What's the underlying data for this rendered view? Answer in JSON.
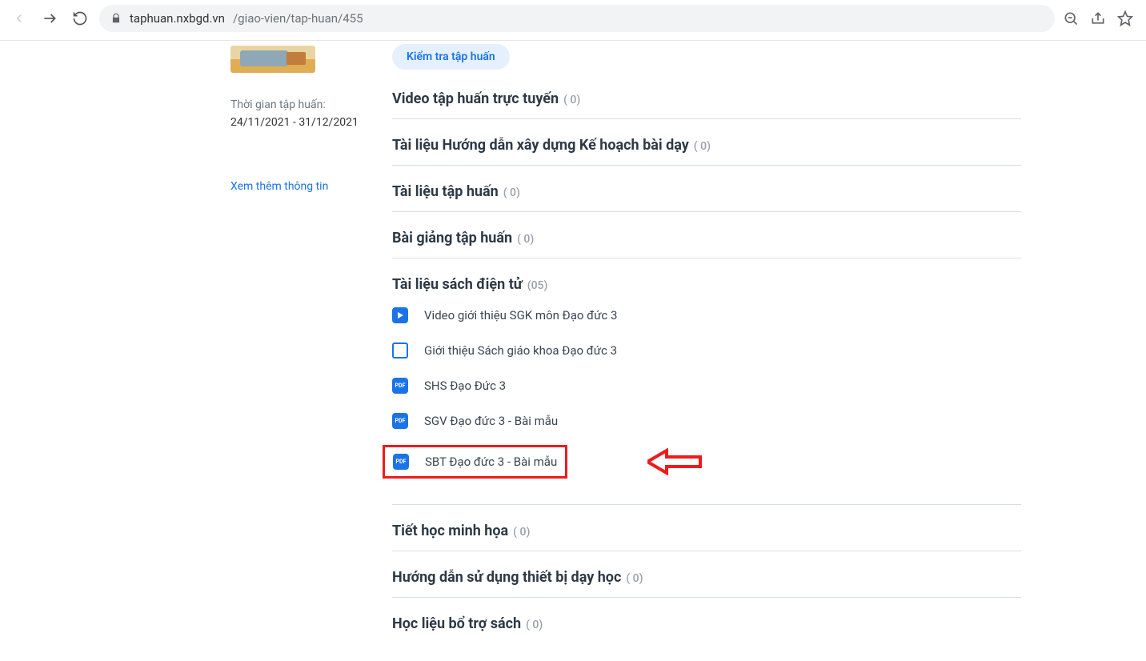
{
  "url": {
    "host": "taphuan.nxbgd.vn",
    "path": "/giao-vien/tap-huan/455"
  },
  "sidebar": {
    "time_label": "Thời gian tập huấn:",
    "dates": "24/11/2021 - 31/12/2021",
    "more_link": "Xem thêm thông tin"
  },
  "pill_label": "Kiểm tra tập huấn",
  "sections": [
    {
      "title": "Video tập huấn trực tuyến",
      "count": "( 0)"
    },
    {
      "title": "Tài liệu Hướng dẫn xây dựng Kế hoạch bài dạy",
      "count": "( 0)"
    },
    {
      "title": "Tài liệu tập huấn",
      "count": "( 0)"
    },
    {
      "title": "Bài giảng tập huấn",
      "count": "( 0)"
    },
    {
      "title": "Tài liệu sách điện tử",
      "count": "(05)"
    },
    {
      "title": "Tiết học minh họa",
      "count": "( 0)"
    },
    {
      "title": "Hướng dẫn sử dụng thiết bị dạy học",
      "count": "( 0)"
    },
    {
      "title": "Học liệu bổ trợ sách",
      "count": "( 0)"
    }
  ],
  "docs": [
    {
      "type": "video",
      "label": "Video giới thiệu SGK môn Đạo đức 3"
    },
    {
      "type": "slide",
      "label": "Giới thiệu Sách giáo khoa Đạo đức 3"
    },
    {
      "type": "pdf",
      "label": "SHS Đạo Đức 3"
    },
    {
      "type": "pdf",
      "label": "SGV Đạo đức 3 - Bài mẫu"
    },
    {
      "type": "pdf",
      "label": "SBT Đạo đức 3 - Bài mẫu",
      "highlighted": true
    }
  ]
}
